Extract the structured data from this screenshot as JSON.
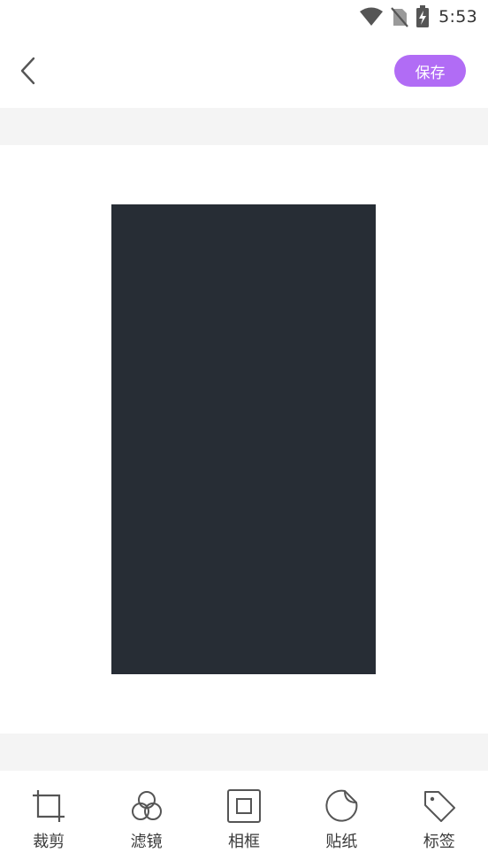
{
  "status_bar": {
    "time": "5:53",
    "icons": [
      "wifi-icon",
      "no-sim-icon",
      "battery-charging-icon"
    ]
  },
  "header": {
    "back_icon": "chevron-left-icon",
    "save_label": "保存"
  },
  "colors": {
    "accent": "#b16cf5",
    "image_preview": "#272d35",
    "band_gray": "#f4f4f4"
  },
  "toolbar": {
    "tools": [
      {
        "label": "裁剪",
        "icon": "crop-icon"
      },
      {
        "label": "滤镜",
        "icon": "filter-icon"
      },
      {
        "label": "相框",
        "icon": "frame-icon"
      },
      {
        "label": "贴纸",
        "icon": "sticker-icon"
      },
      {
        "label": "标签",
        "icon": "tag-icon"
      }
    ]
  }
}
